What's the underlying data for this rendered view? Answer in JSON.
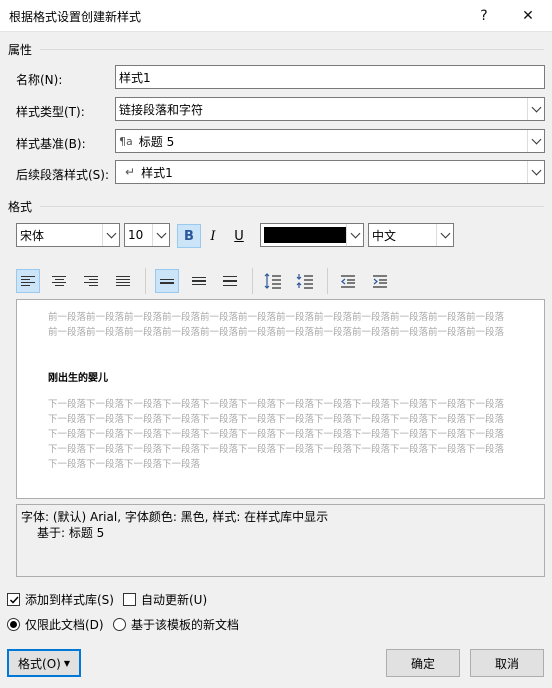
{
  "dialog": {
    "title": "根据格式设置创建新样式",
    "help": "?",
    "close": "✕"
  },
  "properties": {
    "heading": "属性",
    "name_label": "名称(N):",
    "name_value": "样式1",
    "type_label": "样式类型(T):",
    "type_value": "链接段落和字符",
    "based_label": "样式基准(B):",
    "based_glyph": "¶a",
    "based_value": "标题 5",
    "next_label": "后续段落样式(S):",
    "next_glyph": "↵",
    "next_value": "样式1"
  },
  "format": {
    "heading": "格式",
    "font": "宋体",
    "size": "10",
    "bold": "B",
    "italic": "I",
    "underline": "U",
    "color_hex": "#000000",
    "script": "中文"
  },
  "preview": {
    "prev_text": "前一段落前一段落前一段落前一段落前一段落前一段落前一段落前一段落前一段落前一段落前一段落前一段落前一段落前一段落前一段落前一段落前一段落前一段落前一段落前一段落前一段落前一段落前一段落前一段落",
    "sample": "刚出生的婴儿",
    "next_text": "下一段落下一段落下一段落下一段落下一段落下一段落下一段落下一段落下一段落下一段落下一段落下一段落下一段落下一段落下一段落下一段落下一段落下一段落下一段落下一段落下一段落下一段落下一段落下一段落下一段落下一段落下一段落下一段落下一段落下一段落下一段落下一段落下一段落下一段落下一段落下一段落下一段落下一段落下一段落下一段落下一段落下一段落下一段落下一段落下一段落下一段落下一段落下一段落下一段落下一段落下一段落下一段落"
  },
  "description": {
    "line1": "字体: (默认) Arial, 字体颜色: 黑色, 样式: 在样式库中显示",
    "line2": "基于: 标题 5"
  },
  "options": {
    "add_to_gallery": "添加到样式库(S)",
    "add_to_gallery_checked": true,
    "auto_update": "自动更新(U)",
    "auto_update_checked": false,
    "only_this_doc": "仅限此文档(D)",
    "new_docs_template": "基于该模板的新文档"
  },
  "buttons": {
    "format": "格式(O)",
    "ok": "确定",
    "cancel": "取消"
  }
}
